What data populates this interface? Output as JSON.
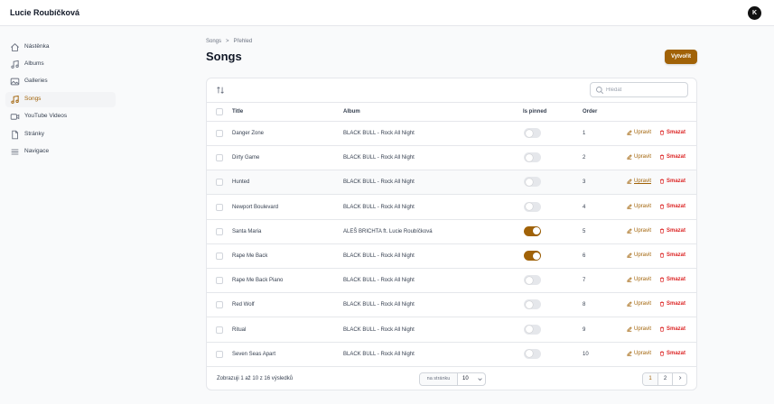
{
  "header": {
    "brand": "Lucie Roubíčková",
    "avatar_initial": "K"
  },
  "sidebar": {
    "items": [
      {
        "label": "Nástěnka",
        "icon": "home-icon"
      },
      {
        "label": "Albums",
        "icon": "music-note-icon"
      },
      {
        "label": "Galleries",
        "icon": "image-icon"
      },
      {
        "label": "Songs",
        "icon": "music-note-icon",
        "active": true
      },
      {
        "label": "YouTube Videos",
        "icon": "video-icon"
      },
      {
        "label": "Stránky",
        "icon": "document-icon"
      },
      {
        "label": "Navigace",
        "icon": "menu-icon"
      }
    ]
  },
  "breadcrumb": {
    "root": "Songs",
    "current": "Přehled"
  },
  "page": {
    "title": "Songs",
    "create_label": "Vytvořit"
  },
  "table": {
    "search_placeholder": "Hledat",
    "columns": [
      "Title",
      "Album",
      "Is pinned",
      "Order"
    ],
    "edit_label": "Upravit",
    "delete_label": "Smazat",
    "rows": [
      {
        "title": "Danger Zone",
        "album": "BLACK BULL - Rock All Night",
        "pinned": false,
        "order": "1"
      },
      {
        "title": "Dirty Game",
        "album": "BLACK BULL - Rock All Night",
        "pinned": false,
        "order": "2"
      },
      {
        "title": "Hunted",
        "album": "BLACK BULL - Rock All Night",
        "pinned": false,
        "order": "3"
      },
      {
        "title": "Newport Boulevard",
        "album": "BLACK BULL - Rock All Night",
        "pinned": false,
        "order": "4"
      },
      {
        "title": "Santa Maria",
        "album": "ALEŠ BRICHTA ft. Lucie Roubíčková",
        "pinned": true,
        "order": "5"
      },
      {
        "title": "Rape Me Back",
        "album": "BLACK BULL - Rock All Night",
        "pinned": true,
        "order": "6"
      },
      {
        "title": "Rape Me Back Piano",
        "album": "BLACK BULL - Rock All Night",
        "pinned": false,
        "order": "7"
      },
      {
        "title": "Red Wolf",
        "album": "BLACK BULL - Rock All Night",
        "pinned": false,
        "order": "8"
      },
      {
        "title": "Ritual",
        "album": "BLACK BULL - Rock All Night",
        "pinned": false,
        "order": "9"
      },
      {
        "title": "Seven Seas Apart",
        "album": "BLACK BULL - Rock All Night",
        "pinned": false,
        "order": "10"
      }
    ]
  },
  "footer": {
    "summary": "Zobrazuji 1 až 10 z 16 výsledků",
    "per_page_label": "na stránku",
    "per_page_value": "10",
    "pages": [
      "1",
      "2"
    ]
  },
  "colors": {
    "accent": "#a16207",
    "danger": "#dc2626"
  }
}
